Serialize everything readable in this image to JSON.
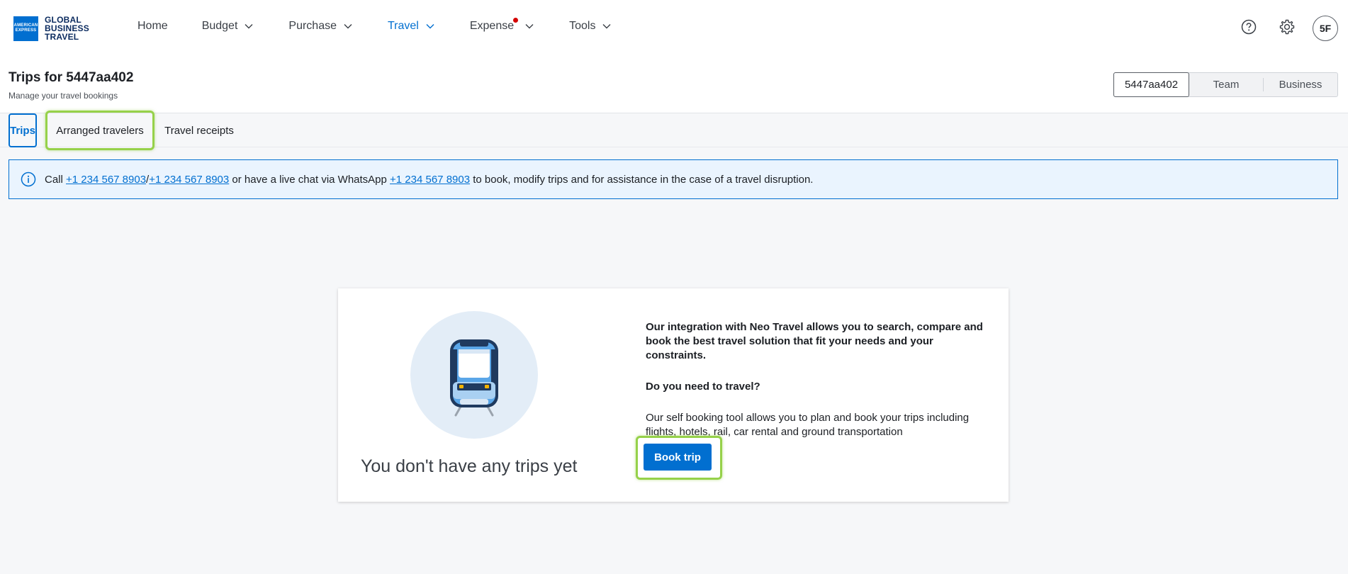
{
  "logo": {
    "badge_lines": [
      "AMERICAN",
      "EXPRESS"
    ],
    "text_lines": [
      "GLOBAL",
      "BUSINESS",
      "TRAVEL"
    ]
  },
  "nav": {
    "items": [
      {
        "label": "Home",
        "has_chevron": false
      },
      {
        "label": "Budget",
        "has_chevron": true
      },
      {
        "label": "Purchase",
        "has_chevron": true
      },
      {
        "label": "Travel",
        "has_chevron": true,
        "active": true
      },
      {
        "label": "Expense",
        "has_chevron": true,
        "notification_dot": true
      },
      {
        "label": "Tools",
        "has_chevron": true
      }
    ]
  },
  "topright": {
    "help_icon": "question-circle-icon",
    "settings_icon": "gear-icon",
    "avatar_initials": "5F"
  },
  "header": {
    "title": "Trips for 5447aa402",
    "subtitle": "Manage your travel bookings",
    "scope_options": [
      "5447aa402",
      "Team",
      "Business"
    ],
    "scope_selected": "5447aa402"
  },
  "tabs": [
    {
      "label": "Trips",
      "active": true
    },
    {
      "label": "Arranged travelers",
      "highlighted": true
    },
    {
      "label": "Travel receipts"
    }
  ],
  "banner": {
    "icon": "info-circle-icon",
    "prefix": "Call ",
    "phone1": "+1 234 567 8903",
    "sep": "/",
    "phone2": "+1 234 567 8903",
    "middle": " or have a live chat via WhatsApp ",
    "phone3": "+1 234 567 8903",
    "suffix": " to book, modify trips and for assistance in the case of a travel disruption."
  },
  "empty_state": {
    "illustration": "train-icon",
    "title": "You don't have any trips yet",
    "intro_before": "Our integration with ",
    "intro_brand": "Neo Travel",
    "intro_after": " allows you to search, compare and book the best travel solution that fit your needs and your constraints.",
    "question": "Do you need to travel?",
    "description": "Our self booking tool allows you to plan and book your trips including flights, hotels, rail, car rental and ground transportation",
    "book_button": "Book trip"
  },
  "colors": {
    "brand_blue": "#016fd0",
    "highlight_green": "#96d14a",
    "notification_red": "#d40000",
    "banner_bg": "#eaf4fe"
  }
}
